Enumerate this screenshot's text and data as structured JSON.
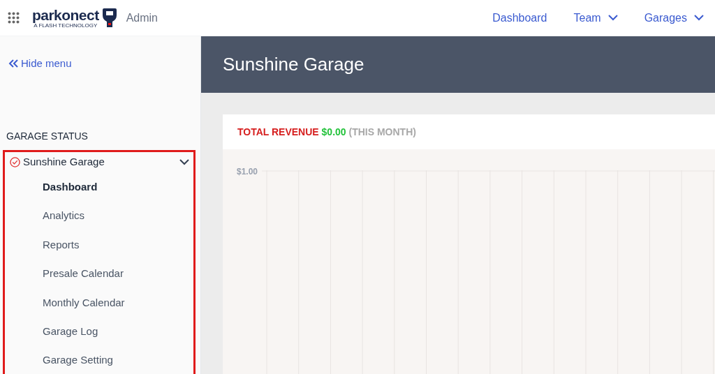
{
  "header": {
    "logo": {
      "name": "parkonect",
      "tagline": "A FLASH TECHNOLOGY"
    },
    "role": "Admin",
    "nav": [
      {
        "label": "Dashboard",
        "dropdown": false
      },
      {
        "label": "Team",
        "dropdown": true
      },
      {
        "label": "Garages",
        "dropdown": true
      }
    ]
  },
  "sidebar": {
    "hide_menu": "Hide menu",
    "section": "GARAGE STATUS",
    "garage": {
      "name": "Sunshine Garage",
      "expanded": true,
      "items": [
        {
          "label": "Dashboard",
          "selected": true
        },
        {
          "label": "Analytics",
          "selected": false
        },
        {
          "label": "Reports",
          "selected": false
        },
        {
          "label": "Presale Calendar",
          "selected": false
        },
        {
          "label": "Monthly Calendar",
          "selected": false
        },
        {
          "label": "Garage Log",
          "selected": false
        },
        {
          "label": "Garage Setting",
          "selected": false
        }
      ]
    }
  },
  "page_title": "Sunshine Garage",
  "revenue_card": {
    "label": "TOTAL REVENUE",
    "amount": "$0.00",
    "period": "(THIS MONTH)",
    "y_tick": "$1.00"
  }
}
